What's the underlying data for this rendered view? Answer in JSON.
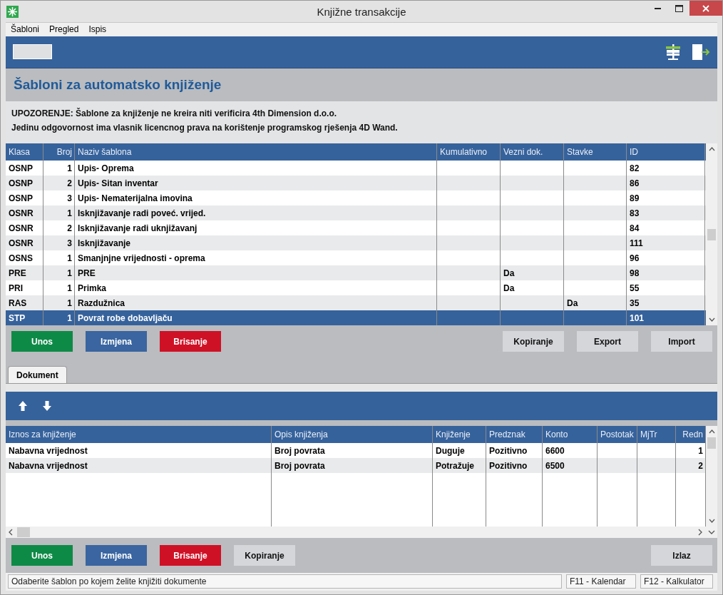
{
  "window": {
    "title": "Knjižne transakcije"
  },
  "menu": [
    "Šabloni",
    "Pregled",
    "Ispis"
  ],
  "header": {
    "title": "Šabloni za automatsko knjiženje",
    "warning": [
      "UPOZORENJE: Šablone za knjiženje ne kreira niti verificira 4th Dimension d.o.o.",
      "Jedinu odgovornost ima vlasnik licencnog prava na korištenje programskog rješenja 4D Wand."
    ]
  },
  "templates": {
    "columns": [
      "Klasa",
      "Broj",
      "Naziv šablona",
      "Kumulativno",
      "Vezni dok.",
      "Stavke",
      "ID"
    ],
    "rows": [
      {
        "cells": [
          "OSNP",
          "1",
          "Upis- Oprema",
          "",
          "",
          "",
          "82"
        ],
        "selected": false
      },
      {
        "cells": [
          "OSNP",
          "2",
          "Upis- Sitan inventar",
          "",
          "",
          "",
          "86"
        ],
        "selected": false
      },
      {
        "cells": [
          "OSNP",
          "3",
          "Upis- Nematerijalna imovina",
          "",
          "",
          "",
          "89"
        ],
        "selected": false
      },
      {
        "cells": [
          "OSNR",
          "1",
          "Isknjižavanje radi poveć. vrijed.",
          "",
          "",
          "",
          "83"
        ],
        "selected": false
      },
      {
        "cells": [
          "OSNR",
          "2",
          "Isknjižavanje radi uknjižavanj",
          "",
          "",
          "",
          "84"
        ],
        "selected": false
      },
      {
        "cells": [
          "OSNR",
          "3",
          "Isknjižavanje",
          "",
          "",
          "",
          "111"
        ],
        "selected": false
      },
      {
        "cells": [
          "OSNS",
          "1",
          "Smanjnjne vrijednosti - oprema",
          "",
          "",
          "",
          "96"
        ],
        "selected": false
      },
      {
        "cells": [
          "PRE",
          "1",
          "PRE",
          "",
          "Da",
          "",
          "98"
        ],
        "selected": false
      },
      {
        "cells": [
          "PRI",
          "1",
          "Primka",
          "",
          "Da",
          "",
          "55"
        ],
        "selected": false
      },
      {
        "cells": [
          "RAS",
          "1",
          "Razdužnica",
          "",
          "",
          "Da",
          "35"
        ],
        "selected": false
      },
      {
        "cells": [
          "STP",
          "1",
          "Povrat robe dobavljaču",
          "",
          "",
          "",
          "101"
        ],
        "selected": true
      }
    ]
  },
  "template_buttons": [
    {
      "label": "Unos",
      "kind": "add"
    },
    {
      "label": "Izmjena",
      "kind": "edit"
    },
    {
      "label": "Brisanje",
      "kind": "delete"
    },
    {
      "label": "Kopiranje",
      "kind": "plain"
    },
    {
      "label": "Export",
      "kind": "plain"
    },
    {
      "label": "Import",
      "kind": "plain"
    }
  ],
  "tabs": [
    {
      "label": "Dokument",
      "selected": true
    }
  ],
  "entries": {
    "columns": [
      "Iznos za knjiženje",
      "Opis knjiženja",
      "Knjiženje",
      "Predznak",
      "Konto",
      "Postotak",
      "MjTr",
      "Redn"
    ],
    "rows": [
      {
        "cells": [
          "Nabavna vrijednost",
          "Broj povrata",
          "Duguje",
          "Pozitivno",
          "6600",
          "",
          "",
          "1"
        ],
        "selected": false
      },
      {
        "cells": [
          "Nabavna vrijednost",
          "Broj povrata",
          "Potražuje",
          "Pozitivno",
          "6500",
          "",
          "",
          "2"
        ],
        "selected": false
      }
    ]
  },
  "bottom_buttons": [
    {
      "label": "Unos",
      "kind": "add"
    },
    {
      "label": "Izmjena",
      "kind": "edit"
    },
    {
      "label": "Brisanje",
      "kind": "delete"
    },
    {
      "label": "Kopiranje",
      "kind": "plain"
    },
    {
      "label": "Izlaz",
      "kind": "plain"
    }
  ],
  "status_bar": [
    "Odaberite šablon po kojem želite knjižiti dokumente",
    "F11 - Kalendar",
    "F12 - Kalkulator"
  ]
}
